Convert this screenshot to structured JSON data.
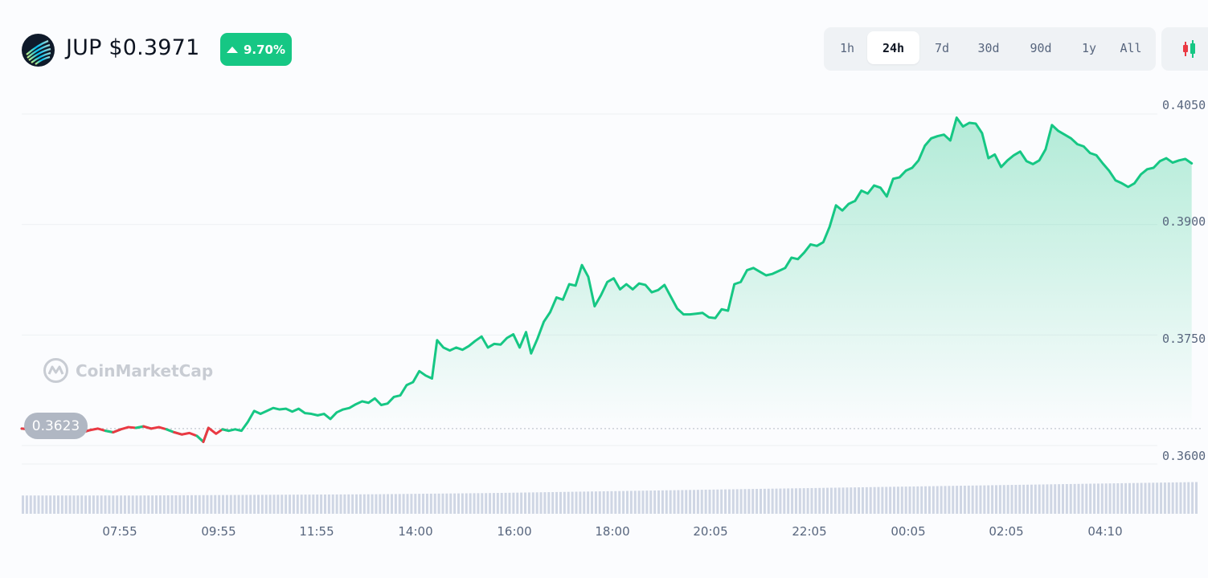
{
  "header": {
    "symbol_price": "JUP $0.3971",
    "change": "9.70%",
    "change_direction": "up",
    "range_buttons": [
      {
        "label": "1h"
      },
      {
        "label": "24h"
      },
      {
        "label": "7d"
      },
      {
        "label": "30d"
      },
      {
        "label": "90d"
      },
      {
        "label": "1y"
      },
      {
        "label": "All"
      }
    ],
    "active_range": "24h",
    "chart_type_icon": "candlestick-icon",
    "logo_icon": "jupiter-logo-icon"
  },
  "watermark": "CoinMarketCap",
  "open_price_label": "0.3623",
  "colors": {
    "up": "#16c784",
    "down": "#ea3943",
    "grid": "#eff2f5",
    "axis_text": "#58667e",
    "volume": "#cfd6e4"
  },
  "chart_data": {
    "type": "area",
    "title": "",
    "xlabel": "",
    "ylabel": "",
    "ylim": [
      0.3575,
      0.4062
    ],
    "open_price": 0.3623,
    "y_ticks": [
      "0.4050",
      "0.3900",
      "0.3750",
      "0.3600"
    ],
    "x_ticks": [
      "07:55",
      "09:55",
      "11:55",
      "14:00",
      "16:00",
      "18:00",
      "20:05",
      "22:05",
      "00:05",
      "02:05",
      "04:10"
    ],
    "series": [
      {
        "values": [
          0.3623,
          0.3622,
          0.3617,
          0.362,
          0.3619,
          0.3621,
          0.362,
          0.3619,
          0.3618,
          0.3621,
          0.3623,
          0.362,
          0.3618,
          0.3622,
          0.3625,
          0.3624,
          0.3626,
          0.3623,
          0.3625,
          0.3622,
          0.3618,
          0.3615,
          0.3617,
          0.3613,
          0.3605,
          0.3624,
          0.3616,
          0.3622,
          0.362,
          0.3622,
          0.362,
          0.3632,
          0.3647,
          0.3643,
          0.3647,
          0.3651,
          0.3649,
          0.365,
          0.3646,
          0.365,
          0.3644,
          0.3643,
          0.3641,
          0.3643,
          0.3636,
          0.3645,
          0.3649,
          0.3651,
          0.3656,
          0.366,
          0.3658,
          0.3664,
          0.3655,
          0.3657,
          0.3666,
          0.3668,
          0.3682,
          0.3686,
          0.3701,
          0.3695,
          0.3691,
          0.3743,
          0.3733,
          0.3729,
          0.3733,
          0.373,
          0.3735,
          0.3742,
          0.3748,
          0.3733,
          0.3738,
          0.3737,
          0.3746,
          0.3751,
          0.3733,
          0.3754,
          0.3725,
          0.3745,
          0.3768,
          0.3781,
          0.3801,
          0.3798,
          0.3819,
          0.3817,
          0.3845,
          0.3829,
          0.3789,
          0.3804,
          0.3822,
          0.3827,
          0.3812,
          0.3819,
          0.3812,
          0.382,
          0.3818,
          0.3808,
          0.3811,
          0.3818,
          0.3802,
          0.3786,
          0.3778,
          0.3778,
          0.3779,
          0.378,
          0.3774,
          0.3773,
          0.3785,
          0.3783,
          0.3819,
          0.3822,
          0.3838,
          0.3841,
          0.3836,
          0.3831,
          0.3833,
          0.3837,
          0.3841,
          0.3855,
          0.3853,
          0.3862,
          0.3873,
          0.3871,
          0.3876,
          0.3897,
          0.3926,
          0.3919,
          0.3928,
          0.3932,
          0.3946,
          0.3942,
          0.3953,
          0.395,
          0.3938,
          0.3962,
          0.3964,
          0.3973,
          0.3977,
          0.3987,
          0.4007,
          0.4017,
          0.402,
          0.4022,
          0.4014,
          0.4045,
          0.4033,
          0.4038,
          0.4037,
          0.4024,
          0.399,
          0.3995,
          0.3978,
          0.3987,
          0.3994,
          0.3999,
          0.3986,
          0.3982,
          0.3987,
          0.4002,
          0.4035,
          0.4027,
          0.4022,
          0.4017,
          0.4009,
          0.4006,
          0.3997,
          0.3994,
          0.3983,
          0.3973,
          0.396,
          0.3956,
          0.3951,
          0.3956,
          0.3968,
          0.3975,
          0.3977,
          0.3986,
          0.399,
          0.3984,
          0.3987,
          0.3989,
          0.3983
        ],
        "x_fraction": [
          0.0,
          0.006,
          0.012,
          0.018,
          0.024,
          0.03,
          0.036,
          0.042,
          0.048,
          0.054,
          0.06,
          0.066,
          0.072,
          0.078,
          0.084,
          0.09,
          0.096,
          0.102,
          0.108,
          0.114,
          0.12,
          0.126,
          0.132,
          0.138,
          0.143,
          0.147,
          0.153,
          0.158,
          0.163,
          0.168,
          0.173,
          0.178,
          0.183,
          0.188,
          0.193,
          0.198,
          0.203,
          0.208,
          0.213,
          0.218,
          0.223,
          0.228,
          0.233,
          0.238,
          0.243,
          0.248,
          0.253,
          0.258,
          0.263,
          0.268,
          0.273,
          0.278,
          0.283,
          0.288,
          0.293,
          0.298,
          0.303,
          0.308,
          0.313,
          0.318,
          0.323,
          0.327,
          0.332,
          0.337,
          0.342,
          0.347,
          0.352,
          0.357,
          0.362,
          0.367,
          0.372,
          0.377,
          0.382,
          0.387,
          0.392,
          0.397,
          0.401,
          0.406,
          0.411,
          0.416,
          0.421,
          0.426,
          0.431,
          0.436,
          0.441,
          0.446,
          0.451,
          0.456,
          0.461,
          0.466,
          0.471,
          0.476,
          0.481,
          0.486,
          0.491,
          0.496,
          0.501,
          0.506,
          0.511,
          0.516,
          0.521,
          0.526,
          0.531,
          0.536,
          0.541,
          0.546,
          0.551,
          0.556,
          0.561,
          0.566,
          0.571,
          0.576,
          0.581,
          0.586,
          0.591,
          0.596,
          0.601,
          0.606,
          0.611,
          0.616,
          0.621,
          0.626,
          0.631,
          0.636,
          0.641,
          0.646,
          0.651,
          0.656,
          0.661,
          0.666,
          0.671,
          0.676,
          0.681,
          0.686,
          0.691,
          0.696,
          0.701,
          0.706,
          0.711,
          0.716,
          0.721,
          0.726,
          0.731,
          0.736,
          0.741,
          0.746,
          0.751,
          0.756,
          0.761,
          0.766,
          0.771,
          0.776,
          0.781,
          0.786,
          0.791,
          0.796,
          0.801,
          0.806,
          0.811,
          0.816,
          0.821,
          0.826,
          0.831,
          0.836,
          0.841,
          0.846,
          0.851,
          0.856,
          0.861,
          0.866,
          0.871,
          0.876,
          0.881,
          0.886,
          0.891,
          0.896,
          0.901,
          0.906,
          0.911,
          0.916,
          0.921
        ]
      }
    ],
    "volume_levels": [
      0.3,
      0.3,
      0.31,
      0.32,
      0.34,
      0.37,
      0.4,
      0.43,
      0.46,
      0.49,
      0.52
    ]
  }
}
